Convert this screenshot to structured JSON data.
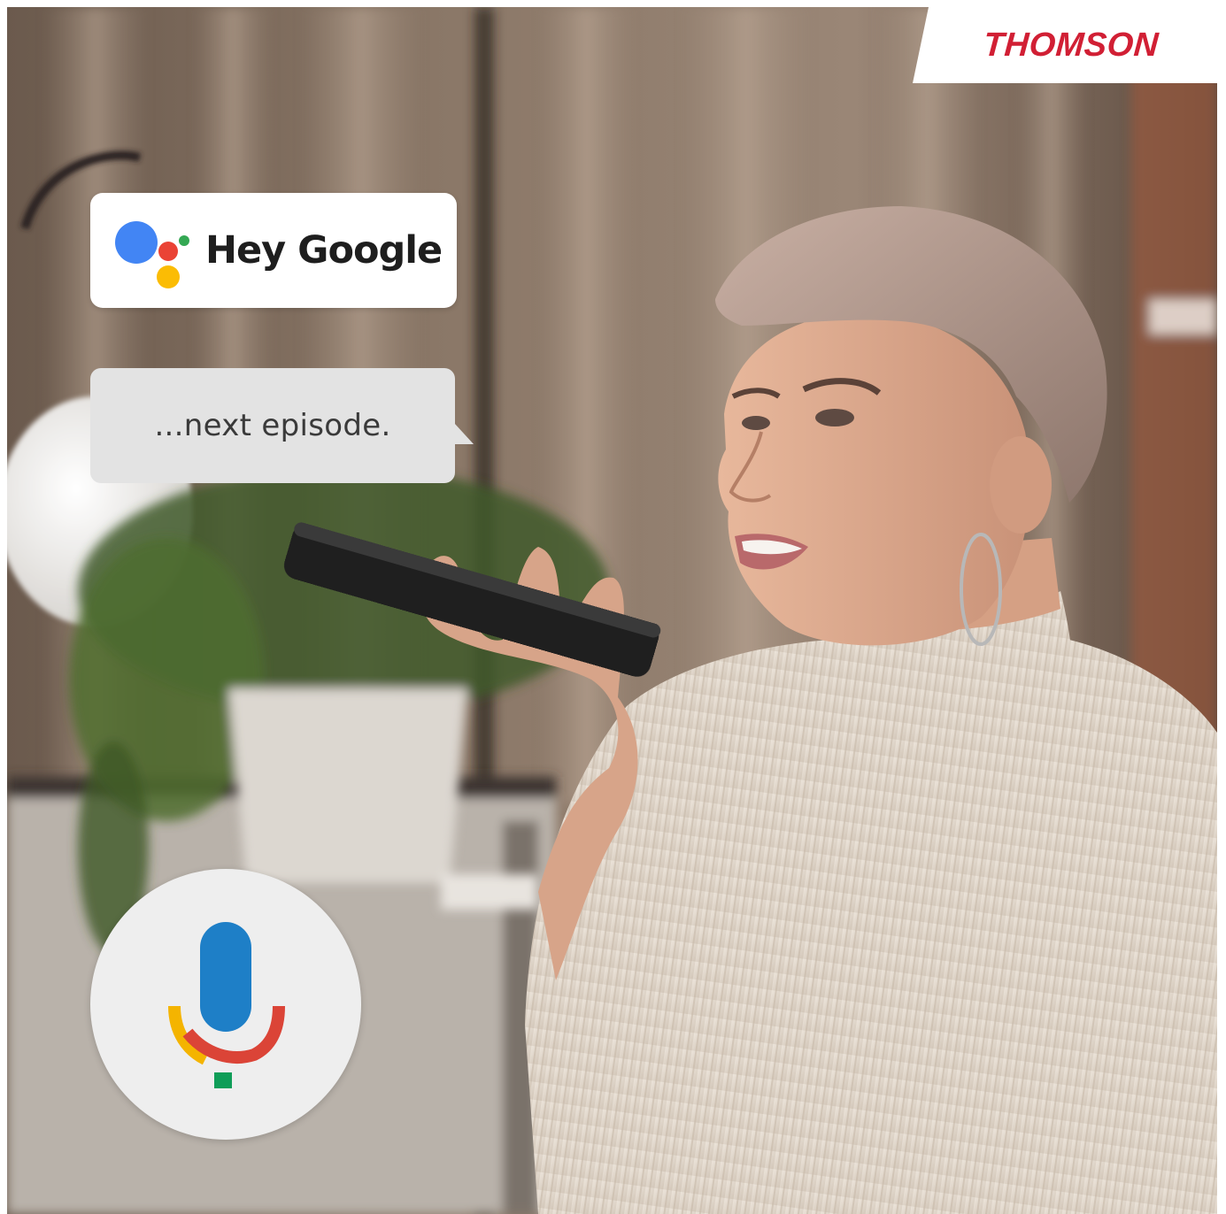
{
  "brand": {
    "name": "THOMSON",
    "color": "#d11f34"
  },
  "voice_prompt": {
    "wake_phrase": "Hey Google",
    "command": "...next episode.",
    "logo_icon": "google-assistant-icon",
    "logo_colors": [
      "#4285f4",
      "#ea4335",
      "#fbbc04",
      "#34a853"
    ]
  },
  "mic": {
    "icon": "microphone-icon",
    "colors": {
      "capsule": "#1e7fc7",
      "left_arc": "#f4b400",
      "right_arc": "#db4437",
      "stand": "#0f9d58"
    }
  },
  "photo": {
    "subject": "woman-speaking-into-remote"
  }
}
